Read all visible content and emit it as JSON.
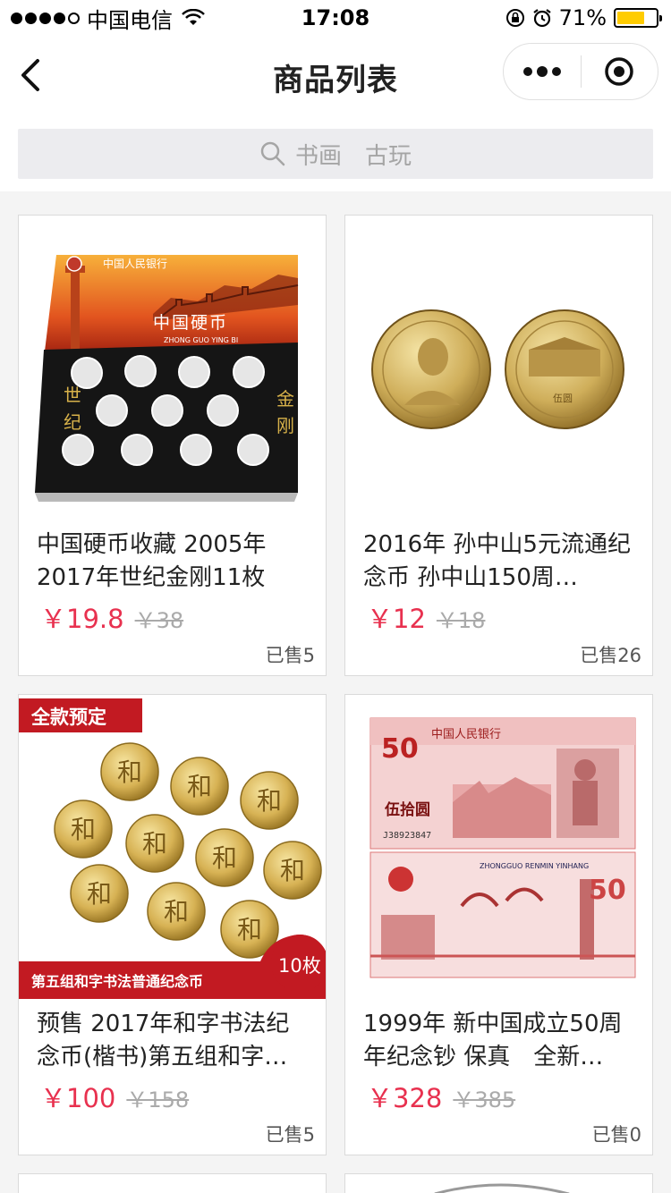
{
  "status_bar": {
    "carrier": "中国电信",
    "time": "17:08",
    "battery": "71%"
  },
  "nav": {
    "title": "商品列表"
  },
  "search": {
    "placeholder": "书画　古玩"
  },
  "products": [
    {
      "title": "中国硬币收藏 2005年2017年世纪金刚11枚硬…",
      "price": "￥19.8",
      "original_price": "￥38",
      "sold": "已售5",
      "image_text": {
        "bank_line": "中国人民银行",
        "headline": "中国硬币",
        "pinyin": "ZHONG GUO YING BI",
        "side_left": "世纪",
        "side_right": "金刚"
      }
    },
    {
      "title": "2016年 孙中山5元流通纪念币 孙中山150周…",
      "price": "￥12",
      "original_price": "￥18",
      "sold": "已售26",
      "image_text": {
        "coin_value": "伍圆"
      }
    },
    {
      "title": "预售 2017年和字书法纪念币(楷书)第五组和字…",
      "price": "￥100",
      "original_price": "￥158",
      "sold": "已售5",
      "image_text": {
        "badge": "全款预定",
        "coin_char": "和",
        "count": "10枚",
        "caption": "第五组和字书法普通纪念币"
      }
    },
    {
      "title": "1999年 新中国成立50周年纪念钞 保真　全新…",
      "price": "￥328",
      "original_price": "￥385",
      "sold": "已售0",
      "image_text": {
        "bank_line": "中国人民银行",
        "denomination": "50",
        "denomination_cn": "伍拾圆",
        "serial": "J38923847",
        "pinyin": "ZHONGGUO RENMIN YINHANG"
      }
    }
  ]
}
